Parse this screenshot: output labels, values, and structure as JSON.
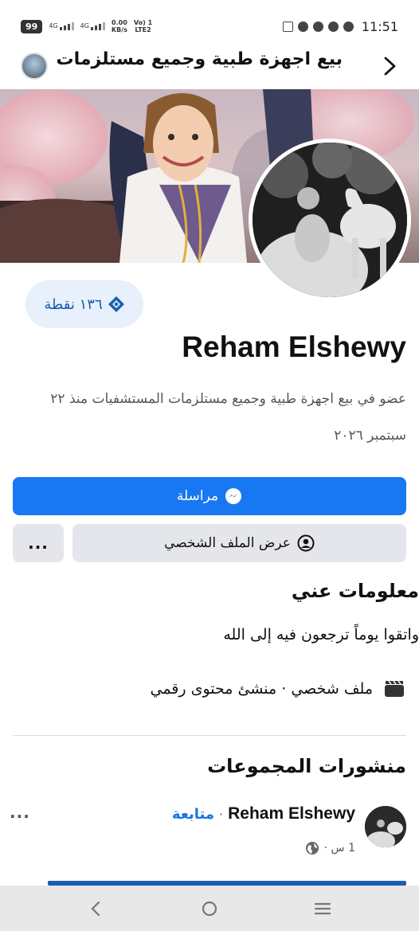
{
  "status_bar": {
    "battery": "99",
    "sim1": "4G",
    "sim2": "4G",
    "speed_value": "0.00",
    "speed_unit": "KB/s",
    "volte_top": "Vo) 1",
    "volte_bottom": "LTE2",
    "time": "11:51"
  },
  "header": {
    "title": "بيع اجهزة طبية وجميع مستلزمات"
  },
  "points": {
    "label": "١٣٦ نقطة"
  },
  "profile": {
    "name": "Reham Elshewy",
    "member_line": "عضو في بيع اجهزة طبية وجميع مستلزمات المستشفيات منذ ٢٢ سبتمبر ٢٠٢٦"
  },
  "buttons": {
    "message": "مراسلة",
    "view_profile": "عرض الملف الشخصي",
    "more": "..."
  },
  "about": {
    "title": "معلومات عني",
    "bio": "واتقوا يوماً ترجعون فيه إلى الله",
    "category": "ملف شخصي · منشئ محتوى رقمي"
  },
  "posts": {
    "title": "منشورات المجموعات",
    "author": "Reham Elshewy",
    "separator": "·",
    "follow": "متابعة",
    "time": "1 س ·",
    "more": "..."
  },
  "colors": {
    "accent": "#1877f2",
    "link": "#1b74e4",
    "button_gray": "#e4e6eb",
    "chip_bg": "#e7f0fb"
  }
}
